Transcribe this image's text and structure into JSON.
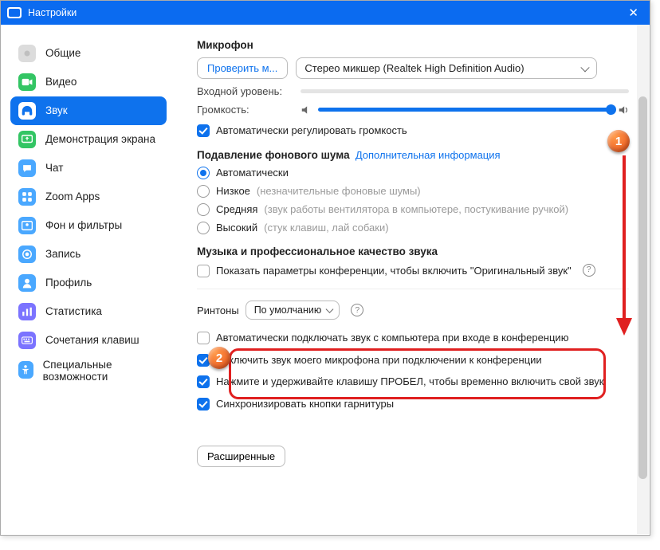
{
  "window": {
    "title": "Настройки"
  },
  "sidebar": {
    "items": [
      {
        "label": "Общие"
      },
      {
        "label": "Видео"
      },
      {
        "label": "Звук"
      },
      {
        "label": "Демонстрация экрана"
      },
      {
        "label": "Чат"
      },
      {
        "label": "Zoom Apps"
      },
      {
        "label": "Фон и фильтры"
      },
      {
        "label": "Запись"
      },
      {
        "label": "Профиль"
      },
      {
        "label": "Статистика"
      },
      {
        "label": "Сочетания клавиш"
      },
      {
        "label": "Специальные возможности"
      }
    ]
  },
  "mic": {
    "title": "Микрофон",
    "test_button": "Проверить м...",
    "device": "Стерео микшер (Realtek High Definition Audio)",
    "input_level_label": "Входной уровень:",
    "volume_label": "Громкость:",
    "auto_adjust": "Автоматически регулировать громкость"
  },
  "noise": {
    "title": "Подавление фонового шума",
    "more_link": "Дополнительная информация",
    "options": [
      {
        "label": "Автоматически",
        "hint": ""
      },
      {
        "label": "Низкое",
        "hint": "(незначительные фоновые шумы)"
      },
      {
        "label": "Средняя",
        "hint": "(звук работы вентилятора в компьютере, постукивание ручкой)"
      },
      {
        "label": "Высокий",
        "hint": "(стук клавиш, лай собаки)"
      }
    ]
  },
  "pro_audio": {
    "title": "Музыка и профессиональное качество звука",
    "option": "Показать параметры конференции, чтобы включить \"Оригинальный звук\""
  },
  "ringtones": {
    "label": "Ринтоны",
    "value": "По умолчанию"
  },
  "options": {
    "auto_join_audio": "Автоматически подключать звук с компьютера при входе в конференцию",
    "mute_on_join": "Отключить звук моего микрофона при подключении к конференции",
    "space_unmute": "Нажмите и удерживайте клавишу ПРОБЕЛ, чтобы временно включить свой звук",
    "sync_headset": "Синхронизировать кнопки гарнитуры"
  },
  "advanced_button": "Расширенные",
  "markers": {
    "one": "1",
    "two": "2"
  }
}
